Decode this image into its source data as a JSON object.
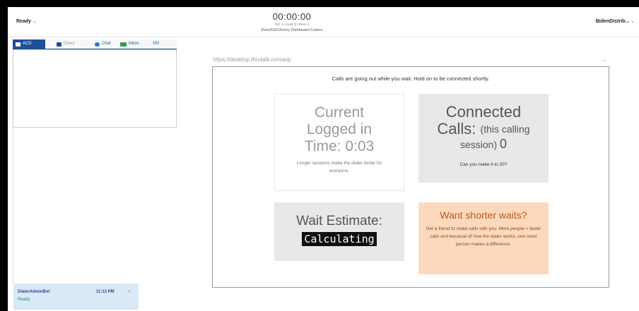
{
  "header": {
    "status": "Ready",
    "timer": "00:00:00",
    "stats": "CIP: 0 | Hold: 0 | Rem: 0",
    "campaign": "Dem2020Victory Distributed Callers",
    "user": "BidenDistrib..."
  },
  "tabs": [
    {
      "label": "ACD",
      "icon": "phone-icon"
    },
    {
      "label": "Direct",
      "icon": "phone-icon"
    },
    {
      "label": "Chat",
      "icon": "chat-icon"
    },
    {
      "label": "Inbox",
      "icon": "inbox-icon"
    },
    {
      "label": "VM",
      "icon": ""
    }
  ],
  "notification": {
    "name": "DialerAdminBot",
    "time": "11:13 PM",
    "status": "Ready"
  },
  "main": {
    "url": "https://desktop.thrutalk.io/ready",
    "message": "Calls are going out while you wait. Hold on to be connected shortly.",
    "logged_line1": "Current",
    "logged_line2": "Logged in",
    "logged_line3": "Time: 0:03",
    "logged_sub": "Longer sessions make the dialer faster for everyone.",
    "connected_line1": "Connected",
    "connected_line2a": "Calls:",
    "connected_line2b": "(this calling",
    "connected_line3": "session)",
    "connected_count": "0",
    "connected_sub": "Can you make it to 20?",
    "wait_title": "Wait Estimate:",
    "wait_value": "Calculating",
    "shorter_title": "Want shorter waits?",
    "shorter_sub": "Get a friend to make calls with you. More people = faster calls and because of how the dialer works, one more person makes a difference."
  },
  "colors": {
    "accent": "#1f4e9a",
    "notification_bg": "#d9e9f5",
    "promo_bg": "#fcd9bd"
  }
}
